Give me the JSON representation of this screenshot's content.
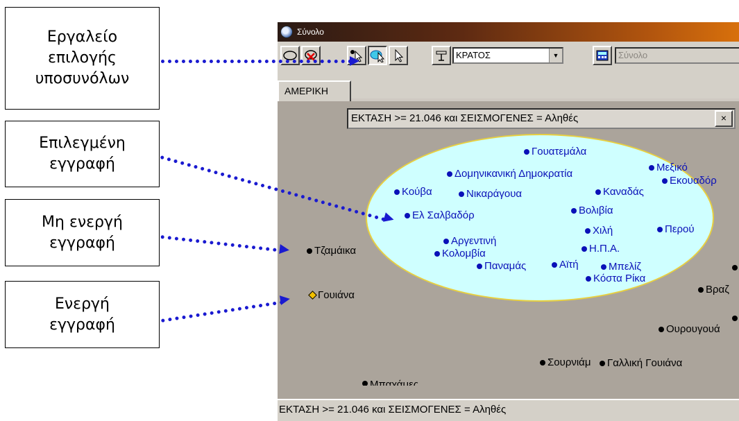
{
  "callouts": [
    {
      "text": "Εργαλείο\nεπιλογής\nυποσυνόλων"
    },
    {
      "text": "Επιλεγμένη\nεγγραφή"
    },
    {
      "text": "Μη ενεργή\nεγγραφή"
    },
    {
      "text": "Ενεργή\nεγγραφή"
    }
  ],
  "window": {
    "title": "Σύνολο",
    "toolbar": {
      "field_combo": "ΚΡΑΤΟΣ",
      "set_combo": "Σύνολο",
      "icons": [
        "open-subset-icon",
        "delete-subset-icon",
        "select-pointer-icon",
        "subset-select-icon",
        "arrow-pointer-icon",
        "field-icon",
        "calculator-icon"
      ]
    },
    "tab": "ΑΜΕΡΙΚΗ",
    "filter": "ΕΚΤΑΣΗ >= 21.046 και ΣΕΙΣΜΟΓΕΝΕΣ = Αληθές",
    "filter_close": "×",
    "status": "ΕΚΤΑΣΗ >= 21.046 και ΣΕΙΣΜΟΓΕΝΕΣ = Αληθές",
    "selected_records": [
      "Γουατεμάλα",
      "Δομηνικανική Δημοκρατία",
      "Μεξικό",
      "Εκουαδόρ",
      "Κούβα",
      "Νικαράγουα",
      "Καναδάς",
      "Βολιβία",
      "Ελ Σαλβαδόρ",
      "Χιλή",
      "Περού",
      "Αργεντινή",
      "Η.Π.Α.",
      "Κολομβία",
      "Αϊτή",
      "Μπελίζ",
      "Παναμάς",
      "Κόστα Ρίκα"
    ],
    "unselected_records": [
      "Τζαμάικα",
      "Βραζ",
      "Ουρουγουά",
      "Σουρνιάμ",
      "Γαλλική Γουιάνα",
      "Μπαχάμες"
    ],
    "active_record": "Γουιάνα"
  },
  "colors": {
    "arrow": "#1a1ad0",
    "selected_text": "#0a10b8",
    "ellipse_fill": "#cfffff",
    "canvas": "#aba49b"
  }
}
